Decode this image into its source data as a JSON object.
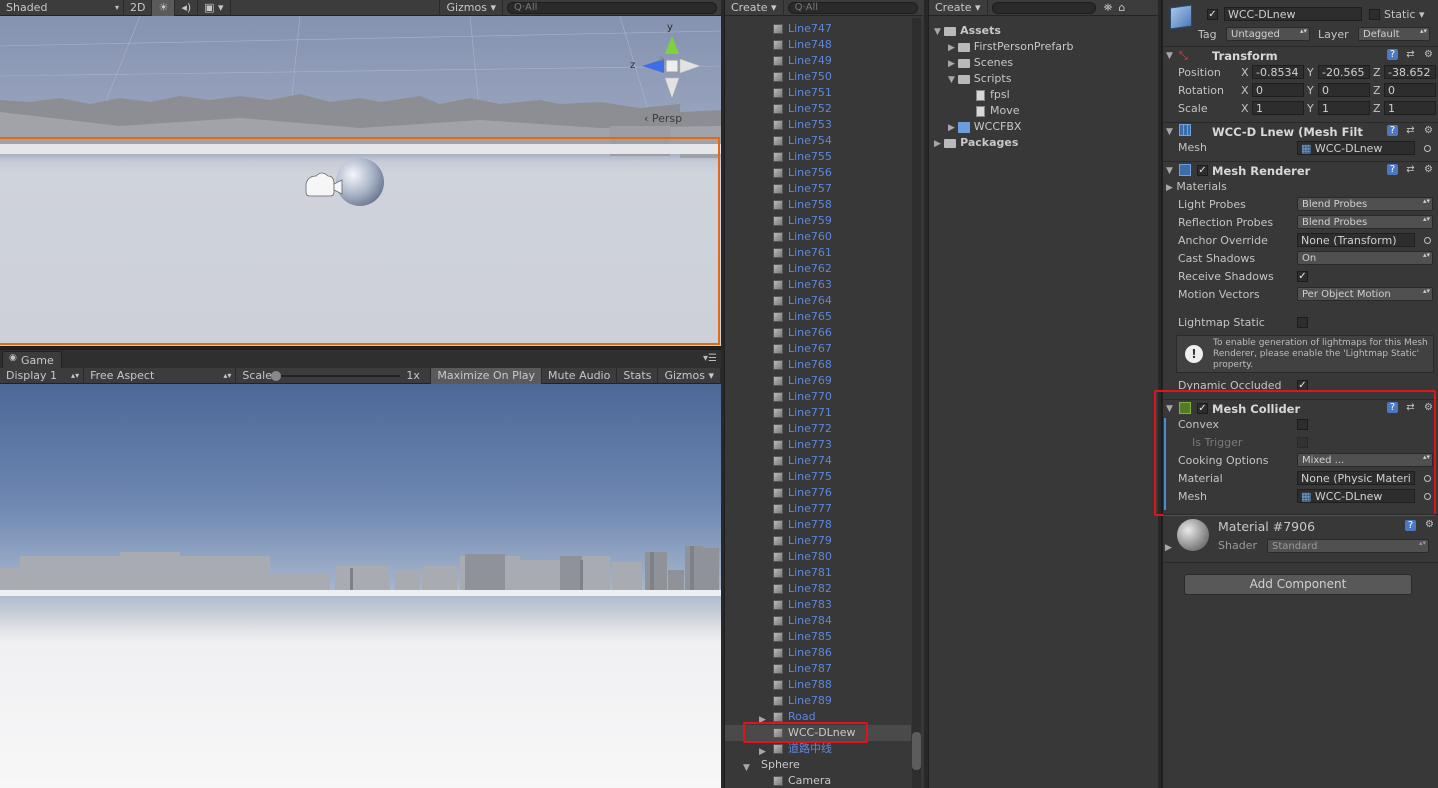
{
  "scene_toolbar": {
    "shading": "Shaded",
    "mode_2d": "2D",
    "gizmos": "Gizmos",
    "search_placeholder": "Q·All"
  },
  "scene_view": {
    "persp_label": "‹ Persp",
    "gizmo_x": "x",
    "gizmo_y": "y",
    "gizmo_z": "z"
  },
  "game": {
    "tab_label": "Game",
    "display": "Display 1",
    "aspect": "Free Aspect",
    "scale_label": "Scale",
    "scale_value": "1x",
    "maximize": "Maximize On Play",
    "mute": "Mute Audio",
    "stats": "Stats",
    "gizmos": "Gizmos"
  },
  "hierarchy": {
    "create": "Create",
    "search_placeholder": "Q·All",
    "lines": [
      "Line747",
      "Line748",
      "Line749",
      "Line750",
      "Line751",
      "Line752",
      "Line753",
      "Line754",
      "Line755",
      "Line756",
      "Line757",
      "Line758",
      "Line759",
      "Line760",
      "Line761",
      "Line762",
      "Line763",
      "Line764",
      "Line765",
      "Line766",
      "Line767",
      "Line768",
      "Line769",
      "Line770",
      "Line771",
      "Line772",
      "Line773",
      "Line774",
      "Line775",
      "Line776",
      "Line777",
      "Line778",
      "Line779",
      "Line780",
      "Line781",
      "Line782",
      "Line783",
      "Line784",
      "Line785",
      "Line786",
      "Line787",
      "Line788",
      "Line789"
    ],
    "road": "Road",
    "selected": "WCC-DLnew",
    "center_line": "道路中线",
    "sphere": "Sphere",
    "camera": "Camera"
  },
  "project": {
    "create": "Create",
    "assets": "Assets",
    "items": [
      "FirstPersonPrefarb",
      "Scenes",
      "Scripts",
      "fpsl",
      "Move",
      "WCCFBX"
    ],
    "packages": "Packages"
  },
  "inspector": {
    "object_name": "WCC-DLnew",
    "static_label": "Static",
    "tag_label": "Tag",
    "tag_value": "Untagged",
    "layer_label": "Layer",
    "layer_value": "Default",
    "transform": {
      "title": "Transform",
      "position_label": "Position",
      "pos_x": "-0.8534",
      "pos_y": "-20.565",
      "pos_z": "-38.652",
      "rotation_label": "Rotation",
      "rot_x": "0",
      "rot_y": "0",
      "rot_z": "0",
      "scale_label": "Scale",
      "scale_x": "1",
      "scale_y": "1",
      "scale_z": "1",
      "axis_x": "X",
      "axis_y": "Y",
      "axis_z": "Z"
    },
    "mesh_filter": {
      "title": "WCC-D Lnew (Mesh Filt",
      "mesh_label": "Mesh",
      "mesh_value": "WCC-DLnew"
    },
    "mesh_renderer": {
      "title": "Mesh Renderer",
      "materials": "Materials",
      "light_probes_label": "Light Probes",
      "light_probes_value": "Blend Probes",
      "reflection_probes_label": "Reflection Probes",
      "reflection_probes_value": "Blend Probes",
      "anchor_override_label": "Anchor Override",
      "anchor_override_value": "None (Transform)",
      "cast_shadows_label": "Cast Shadows",
      "cast_shadows_value": "On",
      "receive_shadows_label": "Receive Shadows",
      "motion_vectors_label": "Motion Vectors",
      "motion_vectors_value": "Per Object Motion",
      "lightmap_static_label": "Lightmap Static",
      "info_text": "To enable generation of lightmaps for this Mesh Renderer, please enable the 'Lightmap Static' property.",
      "dynamic_occluded_label": "Dynamic Occluded"
    },
    "mesh_collider": {
      "title": "Mesh Collider",
      "convex_label": "Convex",
      "is_trigger_label": "Is Trigger",
      "cooking_label": "Cooking Options",
      "cooking_value": "Mixed ...",
      "material_label": "Material",
      "material_value": "None (Physic Materi",
      "mesh_label": "Mesh",
      "mesh_value": "WCC-DLnew"
    },
    "material": {
      "title": "Material #7906",
      "shader_label": "Shader",
      "shader_value": "Standard"
    },
    "add_component": "Add Component"
  }
}
